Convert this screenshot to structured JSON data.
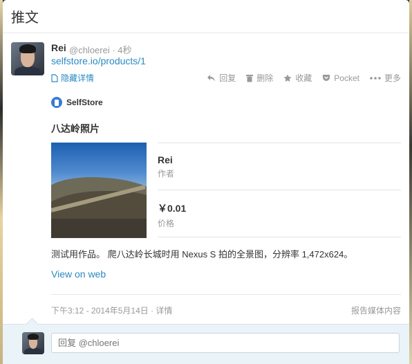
{
  "modal": {
    "title": "推文"
  },
  "tweet": {
    "name": "Rei",
    "handle": "@chloerei",
    "time": "· 4秒",
    "link": "selfstore.io/products/1",
    "hide_detail": "隐藏详情",
    "actions": [
      {
        "label": "回复",
        "icon": "reply-icon"
      },
      {
        "label": "删除",
        "icon": "trash-icon"
      },
      {
        "label": "收藏",
        "icon": "star-icon"
      },
      {
        "label": "Pocket",
        "icon": "pocket-icon"
      },
      {
        "label": "更多",
        "icon": "more-icon"
      }
    ]
  },
  "card": {
    "brand": "SelfStore",
    "title": "八达岭照片",
    "author_value": "Rei",
    "author_label": "作者",
    "price_value": "￥0.01",
    "price_label": "价格"
  },
  "description": "测试用作品。 爬八达岭长城时用 Nexus S 拍的全景图，分辨率 1,472x624。",
  "view_on_web": "View on web",
  "footer": {
    "date": "下午3:12 - 2014年5月14日 · 详情",
    "report": "报告媒体内容"
  },
  "reply": {
    "placeholder": "回复 @chloerei"
  },
  "colors": {
    "link": "#2a8ac2",
    "muted": "#999999",
    "reply_bg": "#eaf3f8"
  }
}
